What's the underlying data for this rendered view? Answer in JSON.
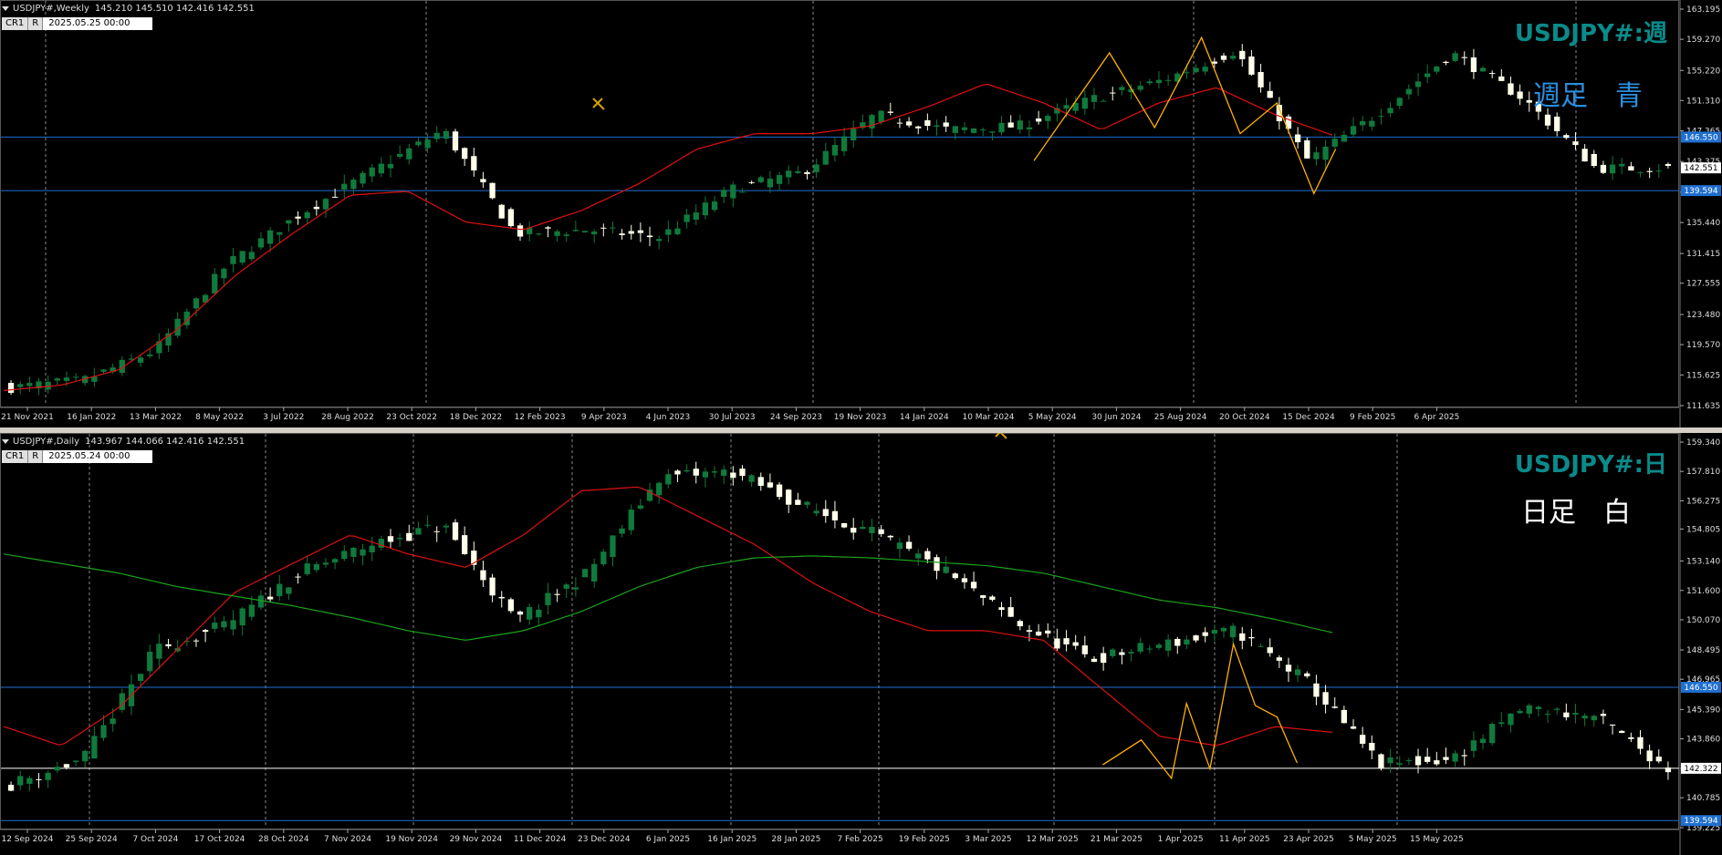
{
  "weekly": {
    "header": {
      "symbol": "USDJPY#,Weekly",
      "ohlc": "145.210 145.510 142.416 142.551"
    },
    "time_box": {
      "cr": "CR1",
      "r": "R",
      "date": "2025.05.25 00:00"
    },
    "symbol_label": "USDJPY#:週",
    "note": "週足　青",
    "note_color": "#2a8fe0",
    "price_axis": [
      "163.195",
      "159.270",
      "155.220",
      "151.310",
      "147.365",
      "143.375",
      "139.394",
      "135.440",
      "131.415",
      "127.555",
      "123.480",
      "119.570",
      "115.625",
      "111.635"
    ],
    "price_labels": [
      {
        "text": "146.550",
        "value": 146.55,
        "bg": "#1f6fd0",
        "color": "#ffffff"
      },
      {
        "text": "142.551",
        "value": 142.551,
        "bg": "#ffffff",
        "color": "#000000"
      },
      {
        "text": "139.594",
        "value": 139.594,
        "bg": "#1f6fd0",
        "color": "#ffffff"
      }
    ],
    "hlines": [
      {
        "value": 146.55,
        "color": "#1f6fd0"
      },
      {
        "value": 139.594,
        "color": "#1f6fd0"
      }
    ],
    "dates": [
      "21 Nov 2021",
      "16 Jan 2022",
      "13 Mar 2022",
      "8 May 2022",
      "3 Jul 2022",
      "28 Aug 2022",
      "23 Oct 2022",
      "18 Dec 2022",
      "12 Feb 2023",
      "9 Apr 2023",
      "4 Jun 2023",
      "30 Jul 2023",
      "24 Sep 2023",
      "19 Nov 2023",
      "14 Jan 2024",
      "10 Mar 2024",
      "5 May 2024",
      "30 Jun 2024",
      "25 Aug 2024",
      "20 Oct 2024",
      "15 Dec 2024",
      "9 Feb 2025",
      "6 Apr 2025"
    ]
  },
  "daily": {
    "header": {
      "symbol": "USDJPY#,Daily",
      "ohlc": "143.967 144.066 142.416 142.551"
    },
    "time_box": {
      "cr": "CR1",
      "r": "R",
      "date": "2025.05.24 00:00"
    },
    "symbol_label": "USDJPY#:日",
    "note": "日足　白",
    "note_color": "#ffffff",
    "price_axis": [
      "159.340",
      "157.810",
      "156.275",
      "154.805",
      "153.140",
      "151.600",
      "150.070",
      "148.495",
      "146.965",
      "145.390",
      "143.860",
      "142.322",
      "140.785",
      "139.225"
    ],
    "price_labels": [
      {
        "text": "146.550",
        "value": 146.55,
        "bg": "#1f6fd0",
        "color": "#ffffff"
      },
      {
        "text": "142.322",
        "value": 142.322,
        "bg": "#ffffff",
        "color": "#000000"
      },
      {
        "text": "139.594",
        "value": 139.594,
        "bg": "#1f6fd0",
        "color": "#ffffff"
      }
    ],
    "hlines": [
      {
        "value": 146.55,
        "color": "#1f6fd0"
      },
      {
        "value": 142.322,
        "color": "#ffffff"
      },
      {
        "value": 139.594,
        "color": "#1f6fd0"
      }
    ],
    "dates": [
      "12 Sep 2024",
      "25 Sep 2024",
      "7 Oct 2024",
      "17 Oct 2024",
      "28 Oct 2024",
      "7 Nov 2024",
      "19 Nov 2024",
      "29 Nov 2024",
      "11 Dec 2024",
      "23 Dec 2024",
      "6 Jan 2025",
      "16 Jan 2025",
      "28 Jan 2025",
      "7 Feb 2025",
      "19 Feb 2025",
      "3 Mar 2025",
      "12 Mar 2025",
      "21 Mar 2025",
      "1 Apr 2025",
      "11 Apr 2025",
      "23 Apr 2025",
      "5 May 2025",
      "15 May 2025"
    ]
  },
  "chart_data": [
    {
      "type": "candlestick",
      "symbol": "USDJPY#",
      "timeframe": "Weekly",
      "ylim": [
        111.635,
        163.195
      ],
      "horizontal_lines": [
        146.55,
        139.594
      ],
      "x": [
        "21 Nov 2021",
        "16 Jan 2022",
        "13 Mar 2022",
        "8 May 2022",
        "3 Jul 2022",
        "28 Aug 2022",
        "23 Oct 2022",
        "18 Dec 2022",
        "12 Feb 2023",
        "9 Apr 2023",
        "4 Jun 2023",
        "30 Jul 2023",
        "24 Sep 2023",
        "19 Nov 2023",
        "14 Jan 2024",
        "10 Mar 2024",
        "5 May 2024",
        "30 Jun 2024",
        "25 Aug 2024",
        "20 Oct 2024",
        "15 Dec 2024",
        "9 Feb 2025",
        "6 Apr 2025",
        "25 May 2025"
      ],
      "series": [
        {
          "values": [
            114.0,
            114.9,
            118.8,
            130.0,
            136.5,
            142.0,
            147.5,
            134.0,
            134.5,
            133.5,
            139.8,
            142.0,
            149.5,
            147.5,
            148.0,
            151.5,
            154.0,
            157.8,
            143.5,
            149.8,
            157.5,
            151.5,
            142.5,
            142.55
          ]
        },
        {
          "values": [
            113.6,
            114.3,
            116.3,
            121.5,
            128.5,
            134.0,
            139.0,
            139.5,
            135.5,
            134.5,
            137.0,
            140.5,
            145.0,
            147.0,
            147.0,
            148.0,
            150.5,
            153.5,
            151.0,
            147.5,
            151.0,
            153.0,
            149.5,
            146.8
          ]
        }
      ],
      "zigzag": [
        [
          0.615,
          143.5
        ],
        [
          0.66,
          157.5
        ],
        [
          0.687,
          147.8
        ],
        [
          0.715,
          159.5
        ],
        [
          0.738,
          147.0
        ],
        [
          0.76,
          151.0
        ],
        [
          0.782,
          139.2
        ],
        [
          0.795,
          145.0
        ]
      ]
    },
    {
      "type": "candlestick",
      "symbol": "USDJPY#",
      "timeframe": "Daily",
      "ylim": [
        139.225,
        159.34
      ],
      "horizontal_lines": [
        146.55,
        142.322,
        139.594
      ],
      "x": [
        "12 Sep 2024",
        "25 Sep 2024",
        "7 Oct 2024",
        "17 Oct 2024",
        "28 Oct 2024",
        "7 Nov 2024",
        "19 Nov 2024",
        "29 Nov 2024",
        "11 Dec 2024",
        "23 Dec 2024",
        "6 Jan 2025",
        "16 Jan 2025",
        "28 Jan 2025",
        "7 Feb 2025",
        "19 Feb 2025",
        "3 Mar 2025",
        "12 Mar 2025",
        "21 Mar 2025",
        "1 Apr 2025",
        "11 Apr 2025",
        "23 Apr 2025",
        "5 May 2025",
        "15 May 2025",
        "23 May 2025"
      ],
      "series": [
        {
          "values": [
            141.5,
            142.8,
            148.5,
            149.8,
            152.5,
            154.0,
            155.0,
            150.0,
            152.5,
            157.5,
            157.8,
            156.0,
            154.5,
            152.5,
            149.8,
            148.0,
            148.8,
            149.5,
            146.8,
            142.5,
            142.8,
            145.5,
            145.0,
            142.32
          ]
        },
        {
          "values": [
            144.5,
            143.5,
            145.5,
            148.5,
            151.5,
            153.0,
            154.5,
            153.5,
            152.8,
            154.5,
            156.8,
            157.0,
            155.5,
            154.0,
            152.0,
            150.5,
            149.5,
            149.5,
            149.0,
            146.5,
            144.0,
            143.5,
            144.5,
            144.2
          ]
        },
        {
          "values": [
            153.5,
            153.0,
            152.5,
            151.8,
            151.3,
            150.8,
            150.2,
            149.5,
            149.0,
            149.5,
            150.5,
            151.8,
            152.8,
            153.3,
            153.4,
            153.3,
            153.1,
            152.9,
            152.5,
            151.8,
            151.1,
            150.7,
            150.1,
            149.4
          ]
        }
      ],
      "zigzag": [
        [
          0.656,
          142.5
        ],
        [
          0.679,
          143.8
        ],
        [
          0.697,
          141.8
        ],
        [
          0.706,
          145.7
        ],
        [
          0.72,
          142.3
        ],
        [
          0.734,
          148.8
        ],
        [
          0.747,
          145.6
        ],
        [
          0.76,
          145.0
        ],
        [
          0.772,
          142.6
        ]
      ]
    }
  ]
}
